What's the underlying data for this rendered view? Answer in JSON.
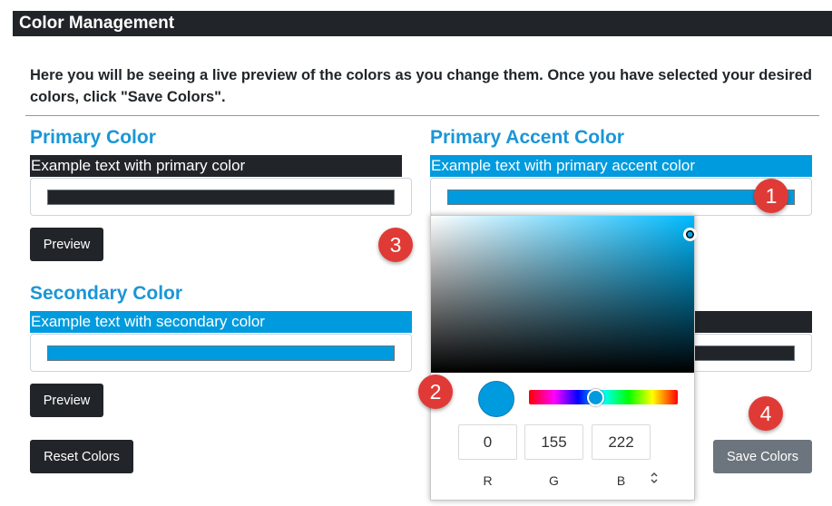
{
  "header": {
    "title": "Color Management"
  },
  "intro": "Here you will be seeing a live preview of the colors as you change them. Once you have selected your desired colors, click \"Save Colors\".",
  "primary": {
    "title": "Primary Color",
    "example": "Example text with primary color",
    "color": "#212529",
    "preview_label": "Preview"
  },
  "accent": {
    "title": "Primary Accent Color",
    "example": "Example text with primary accent color",
    "color": "#009bde"
  },
  "secondary": {
    "title": "Secondary Color",
    "example": "Example text with secondary color",
    "color": "#009bde",
    "preview_label": "Preview"
  },
  "secondary_accent": {
    "color": "#212529"
  },
  "buttons": {
    "reset": "Reset Colors",
    "save": "Save Colors"
  },
  "picker": {
    "values": {
      "r": "0",
      "g": "155",
      "b": "222"
    },
    "labels": {
      "r": "R",
      "g": "G",
      "b": "B"
    },
    "mode_toggle_icon": "⌃⌄"
  },
  "badges": [
    "1",
    "2",
    "3",
    "4"
  ],
  "colors": {
    "dark": "#212529",
    "accent": "#009bde",
    "title_blue": "#1b96d6",
    "badge_red": "#e03a36",
    "grey_button": "#6c757d"
  }
}
